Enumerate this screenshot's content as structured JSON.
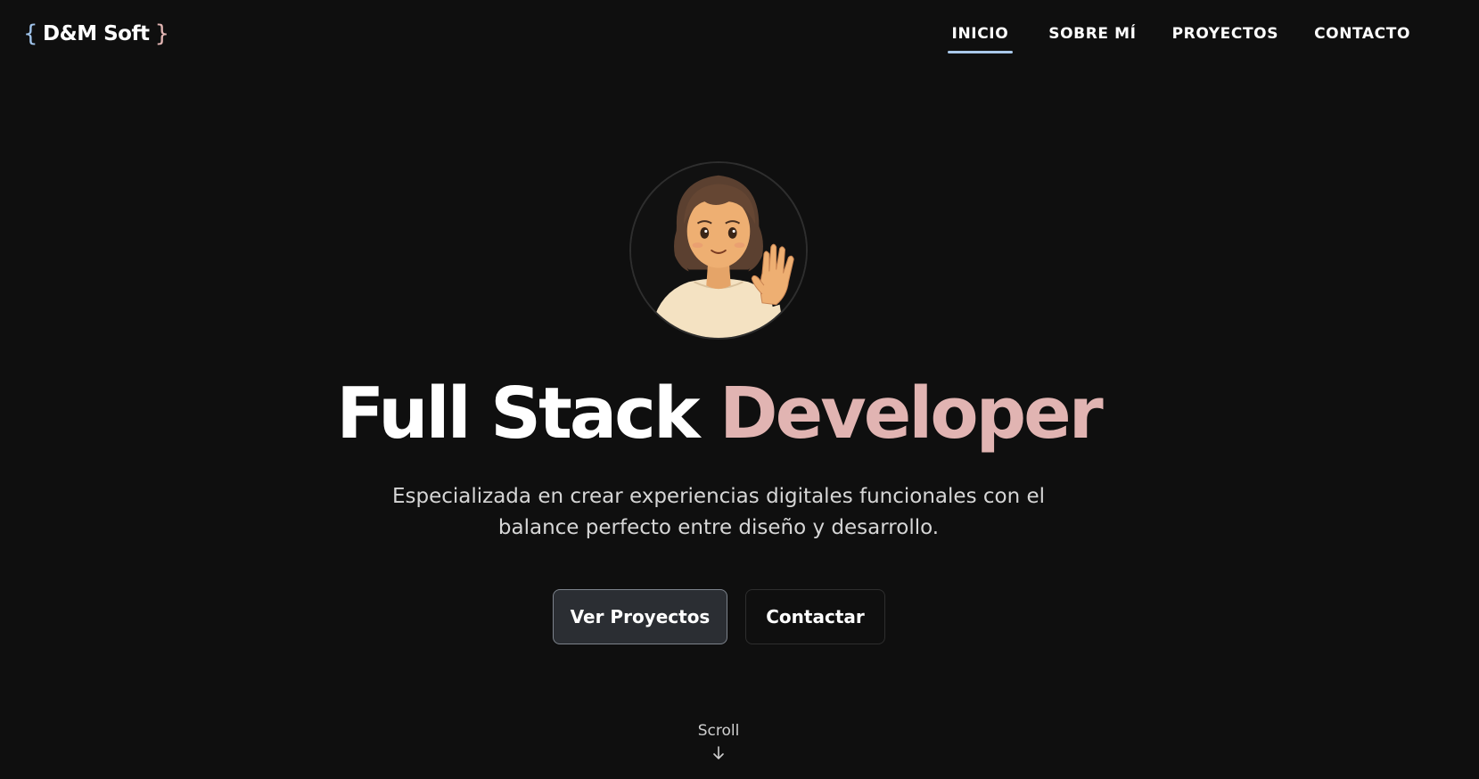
{
  "header": {
    "logo": {
      "brace_open": "{",
      "name": "D&M Soft",
      "brace_close": "}"
    },
    "nav": [
      {
        "label": "INICIO",
        "active": true
      },
      {
        "label": "SOBRE MÍ",
        "active": false
      },
      {
        "label": "PROYECTOS",
        "active": false
      },
      {
        "label": "CONTACTO",
        "active": false
      }
    ]
  },
  "hero": {
    "avatar_icon": "waving-girl-avatar",
    "title_main": "Full Stack",
    "title_accent": "Developer",
    "subtitle_line1": "Especializada en crear experiencias digitales funcionales con el",
    "subtitle_line2": "balance perfecto entre diseño y desarrollo.",
    "primary_button": "Ver Proyectos",
    "secondary_button": "Contactar",
    "scroll_label": "Scroll",
    "scroll_icon": "arrow-down-icon"
  },
  "colors": {
    "background": "#0f0f0f",
    "accent_pink": "#e1b4b2",
    "accent_blue": "#a9c8ea",
    "button_primary_bg": "#2b2e33"
  }
}
